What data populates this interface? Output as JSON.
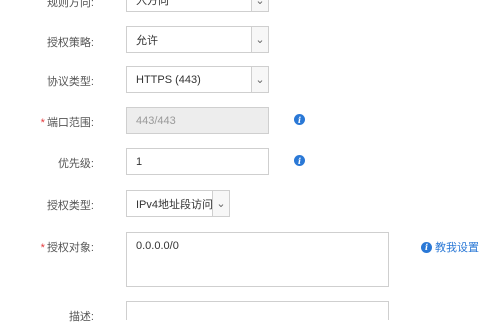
{
  "form": {
    "top_partial": {
      "label": "规则方向:",
      "value": "入方向"
    },
    "policy": {
      "label": "授权策略:",
      "value": "允许"
    },
    "protocol": {
      "label": "协议类型:",
      "value": "HTTPS (443)"
    },
    "port_range": {
      "required_mark": "*",
      "label": "端口范围:",
      "value": "443/443"
    },
    "priority": {
      "label": "优先级:",
      "value": "1"
    },
    "auth_type": {
      "label": "授权类型:",
      "value": "IPv4地址段访问"
    },
    "auth_object": {
      "required_mark": "*",
      "label": "授权对象:",
      "value": "0.0.0.0/0",
      "help_text": "教我设置"
    },
    "description": {
      "label": "描述:",
      "value": ""
    }
  },
  "icons": {
    "info": "info-icon",
    "dropdown": "chevron-down-icon"
  },
  "colors": {
    "accent": "#2a78d6",
    "required": "#e4393c",
    "border": "#cfcfcf",
    "disabled_bg": "#ededed"
  }
}
